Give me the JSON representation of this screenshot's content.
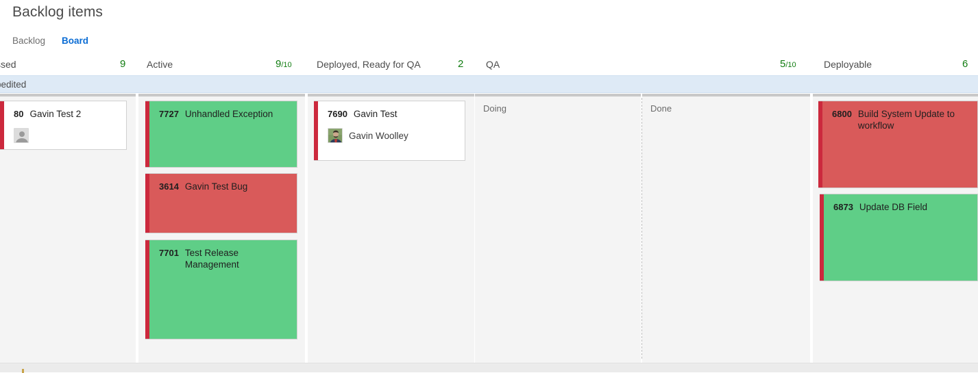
{
  "header": {
    "title": "Backlog items",
    "tabs": [
      {
        "label": "Backlog",
        "active": false
      },
      {
        "label": "Board",
        "active": true
      }
    ]
  },
  "board": {
    "swimlane": {
      "label": "pedited",
      "full_label_note": "Expedited (clipped at left edge)"
    },
    "columns": [
      {
        "name": "ssed",
        "count": "9",
        "limit": "",
        "split": false,
        "subcolumns": []
      },
      {
        "name": "Active",
        "count": "9",
        "limit": "/10",
        "split": false,
        "subcolumns": []
      },
      {
        "name": "Deployed, Ready for QA",
        "count": "2",
        "limit": "",
        "split": false,
        "subcolumns": []
      },
      {
        "name": "QA",
        "count": "5",
        "limit": "/10",
        "split": true,
        "subcolumns": [
          "Doing",
          "Done"
        ]
      },
      {
        "name": "Deployable",
        "count": "6",
        "limit": "",
        "split": false,
        "subcolumns": []
      }
    ],
    "cards": [
      {
        "id": "80",
        "title": "Gavin Test 2",
        "color": "white",
        "column": "ssed",
        "assignee": "",
        "has_avatar": true,
        "clipped": true
      },
      {
        "id": "7727",
        "title": "Unhandled Exception",
        "color": "green",
        "column": "Active",
        "assignee": "",
        "has_avatar": false,
        "clipped": false
      },
      {
        "id": "3614",
        "title": "Gavin Test Bug",
        "color": "red",
        "column": "Active",
        "assignee": "",
        "has_avatar": false,
        "clipped": false
      },
      {
        "id": "7701",
        "title": "Test Release Management",
        "color": "green",
        "column": "Active",
        "assignee": "",
        "has_avatar": false,
        "clipped": false
      },
      {
        "id": "7690",
        "title": "Gavin Test",
        "color": "white",
        "column": "Deployed, Ready for QA",
        "assignee": "Gavin Woolley",
        "has_avatar": true,
        "clipped": false
      },
      {
        "id": "6800",
        "title": "Build System Update to workflow",
        "color": "red",
        "column": "Deployable",
        "assignee": "",
        "has_avatar": false,
        "clipped": false
      },
      {
        "id": "6873",
        "title": "Update DB Field",
        "color": "green",
        "column": "Deployable",
        "assignee": "",
        "has_avatar": false,
        "clipped": false
      }
    ]
  },
  "colors": {
    "card_green": "#5fce87",
    "card_red": "#d95a5a",
    "card_stripe": "#cc293d",
    "swimlane_band": "#deeaf6",
    "column_background": "#f4f4f4",
    "column_top_border": "#c8c8c8",
    "count_text": "#107c10",
    "active_tab": "#0a6cd4"
  }
}
